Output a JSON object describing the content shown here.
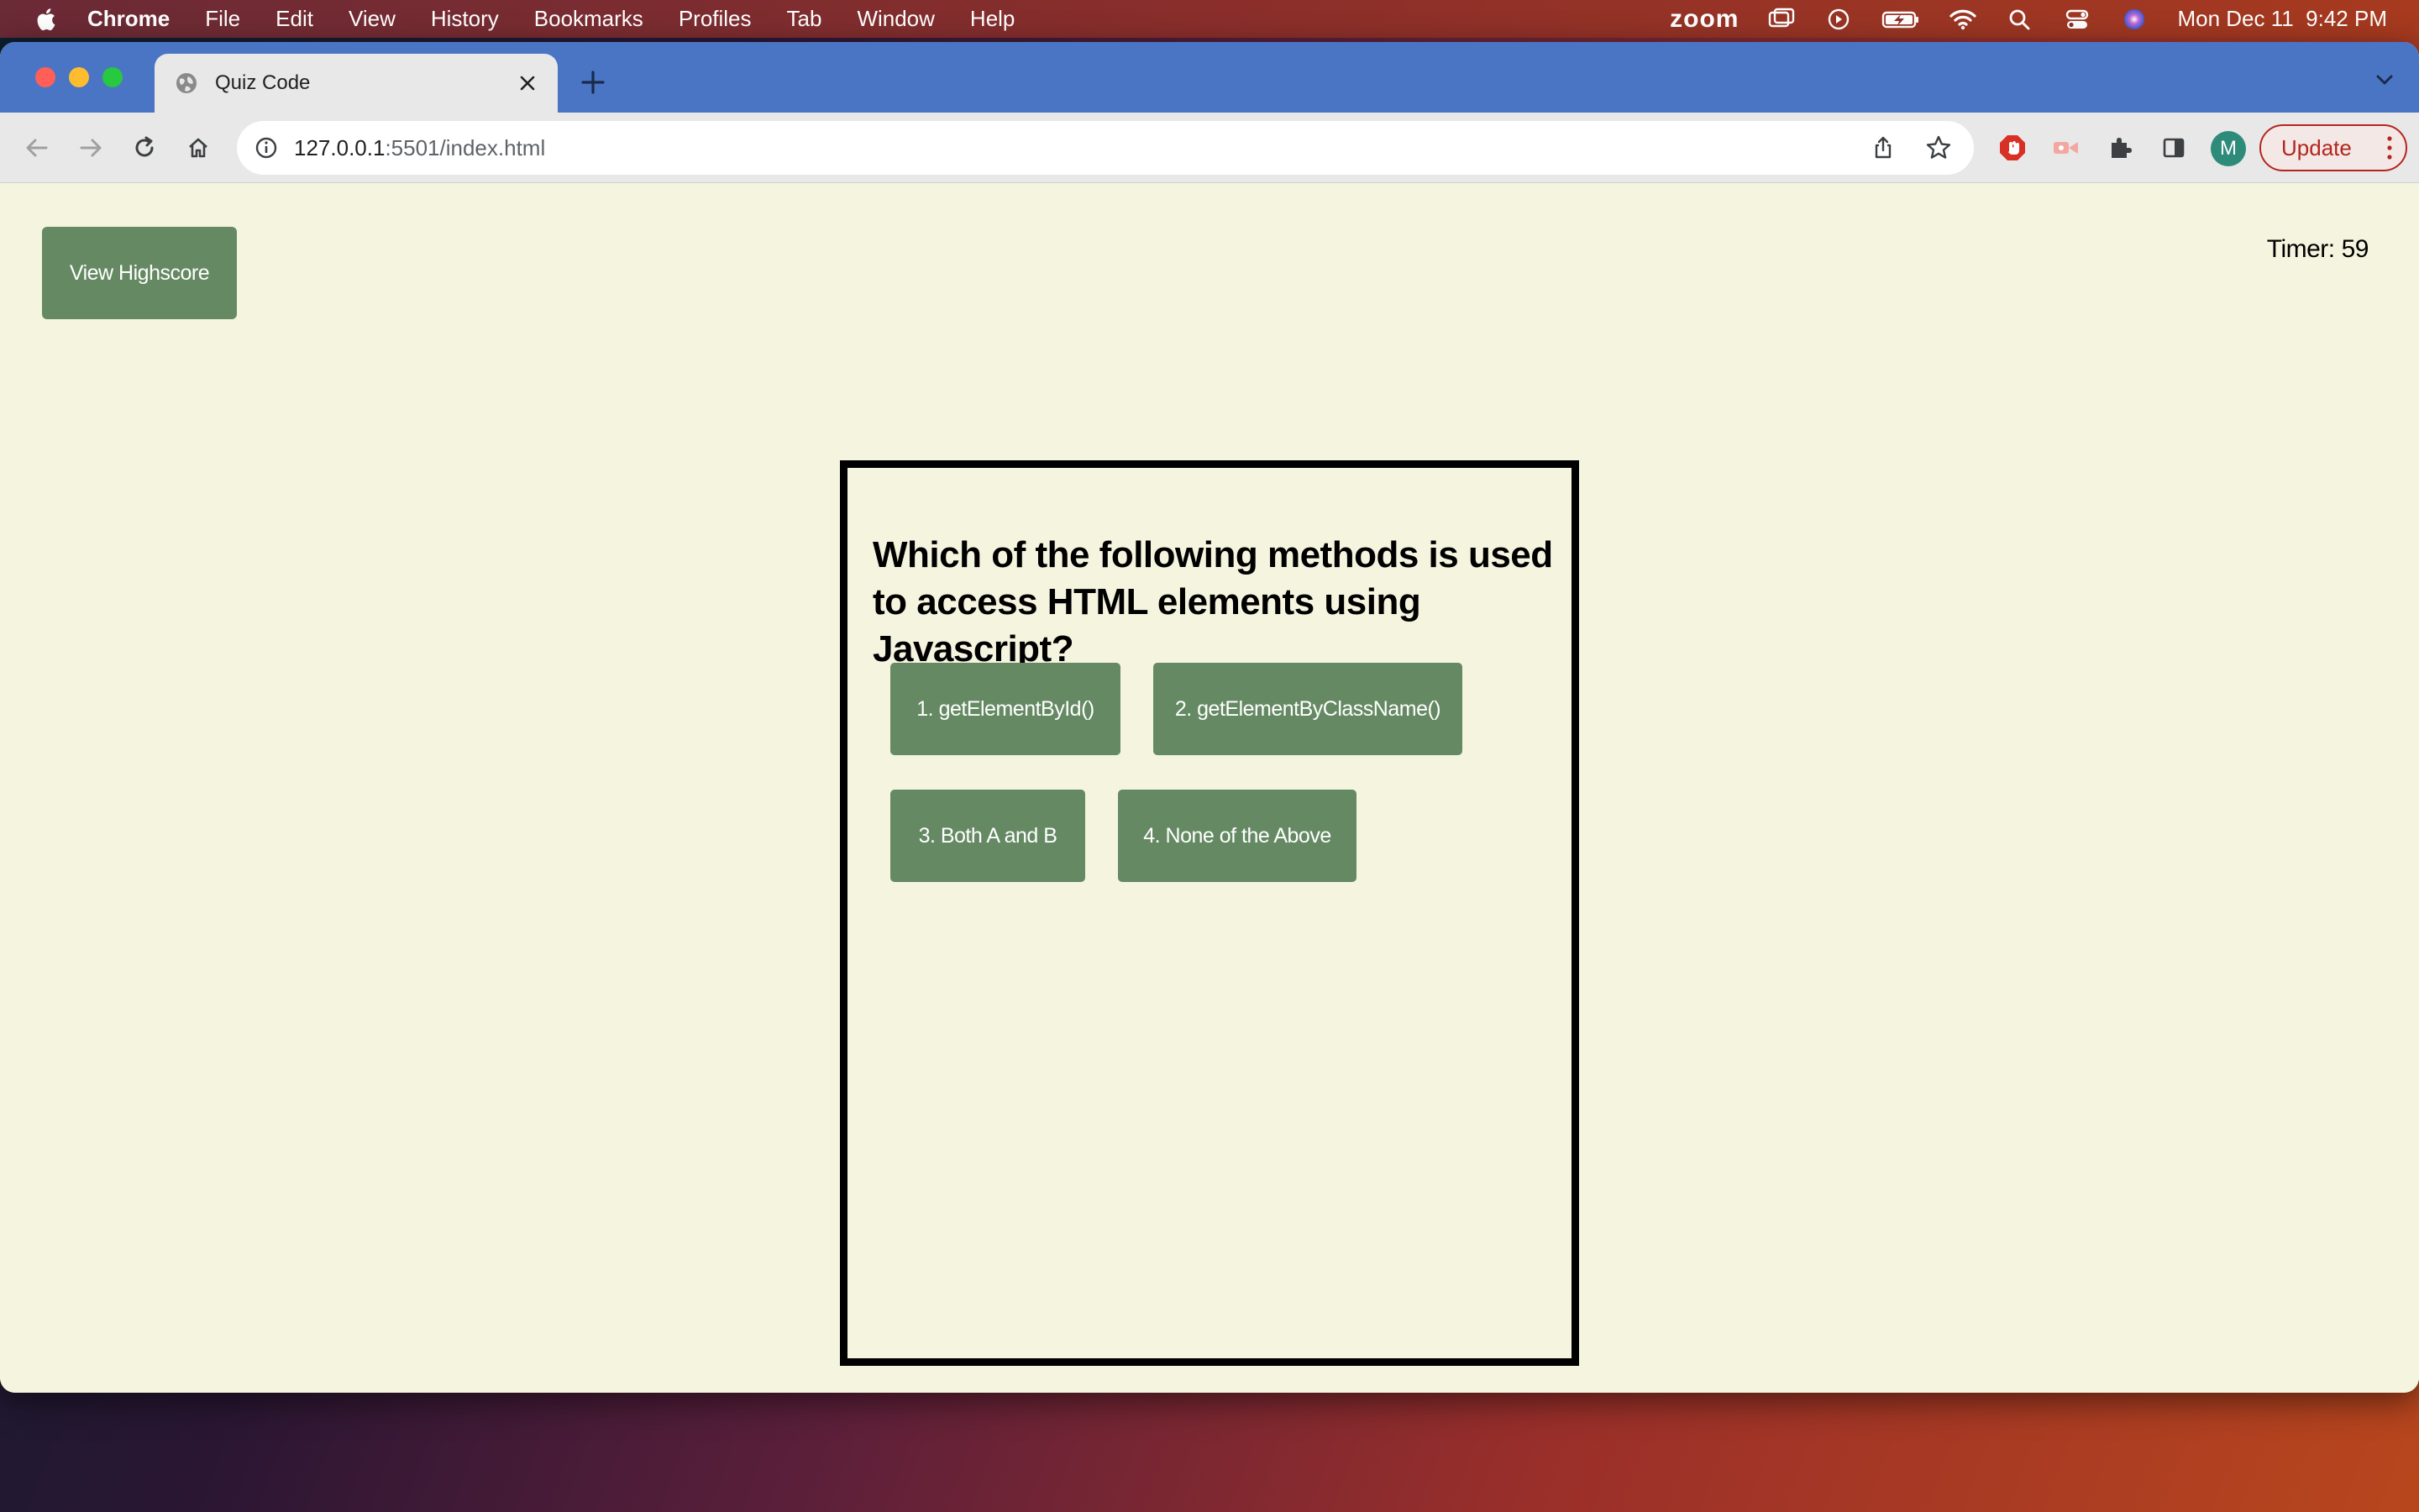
{
  "menubar": {
    "app_name": "Chrome",
    "items": [
      "File",
      "Edit",
      "View",
      "History",
      "Bookmarks",
      "Profiles",
      "Tab",
      "Window",
      "Help"
    ],
    "zoom_label": "zoom",
    "clock": "Mon Dec 11  9:42 PM"
  },
  "browser": {
    "tab_title": "Quiz Code",
    "url_host": "127.0.0.1",
    "url_rest": ":5501/index.html",
    "avatar_initial": "M",
    "update_label": "Update"
  },
  "page": {
    "highscore_label": "View Highscore",
    "timer_label": "Timer:",
    "timer_value": "59",
    "question": "Which of the following methods is used to access HTML elements using Javascript?",
    "answers": [
      "1. getElementById()",
      "2. getElementByClassName()",
      "3. Both A and B",
      "4. None of the Above"
    ]
  },
  "colors": {
    "button_green": "#658a63",
    "page_background": "#f5f5df",
    "tabstrip_blue": "#4a75c4",
    "update_red": "#b3261e"
  }
}
